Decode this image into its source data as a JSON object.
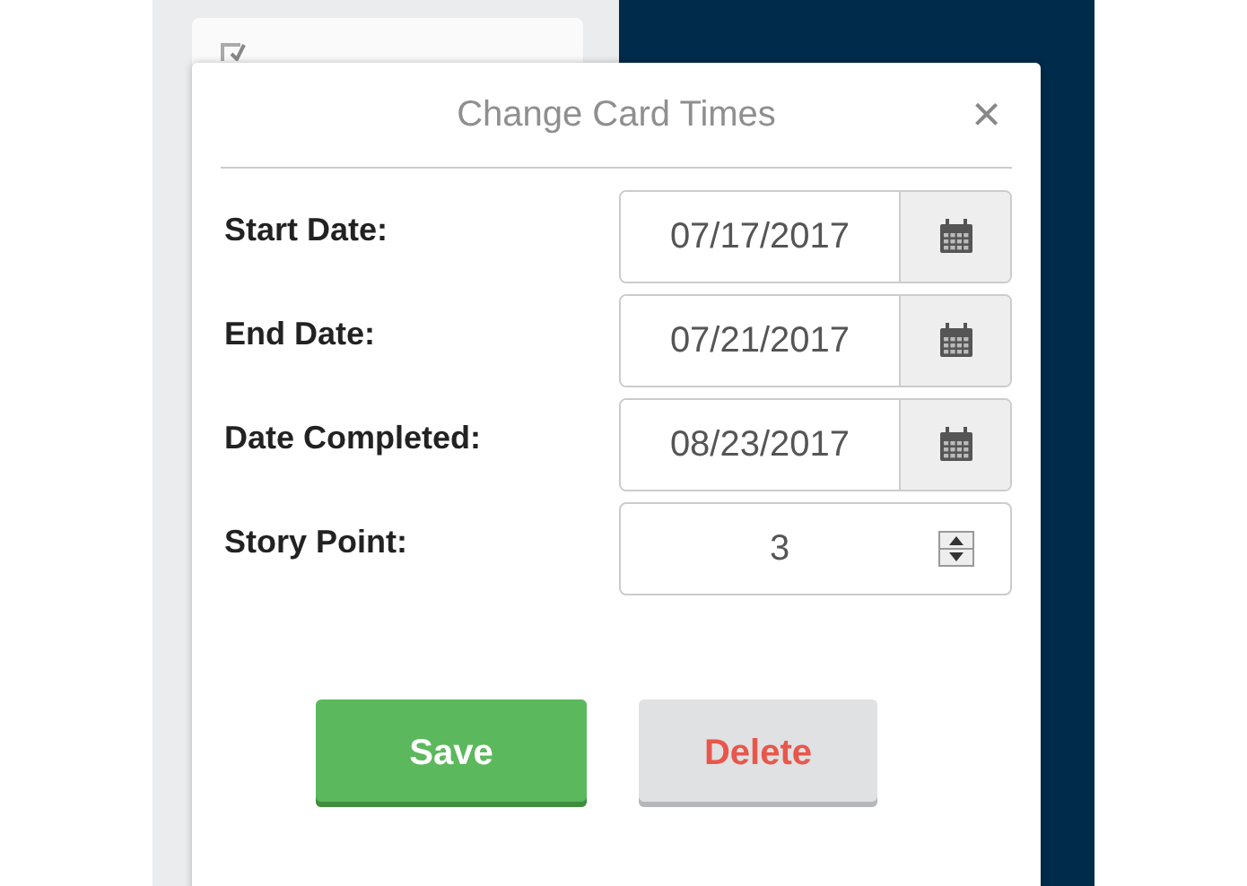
{
  "modal": {
    "title": "Change Card Times",
    "close": "×"
  },
  "fields": [
    {
      "kind": "date",
      "label": "Start Date:",
      "value": "07/17/2017"
    },
    {
      "kind": "date",
      "label": "End Date:",
      "value": "07/21/2017"
    },
    {
      "kind": "date",
      "label": "Date Completed:",
      "value": "08/23/2017"
    },
    {
      "kind": "number",
      "label": "Story Point:",
      "value": "3"
    }
  ],
  "buttons": [
    {
      "kind": "primary",
      "label": "Save"
    },
    {
      "kind": "danger",
      "label": "Delete"
    }
  ]
}
